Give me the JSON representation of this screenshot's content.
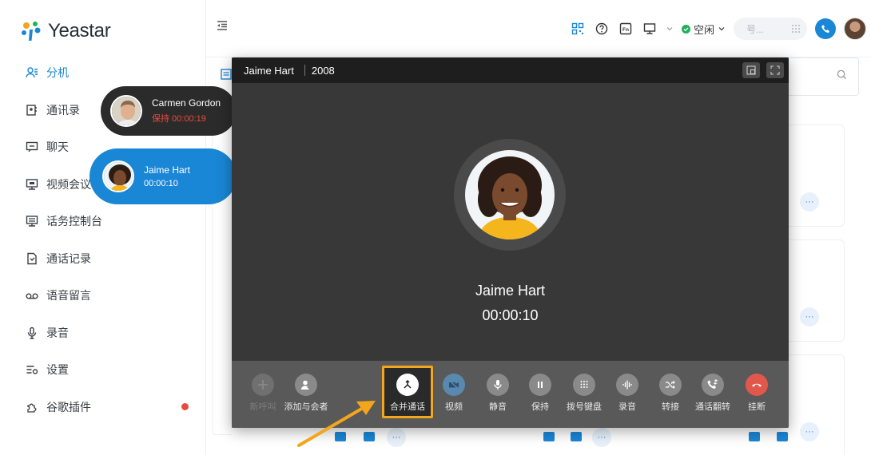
{
  "brand": {
    "name": "Yeastar"
  },
  "sidebar": {
    "items": [
      {
        "label": "分机",
        "icon": "extension-icon",
        "active": true
      },
      {
        "label": "通讯录",
        "icon": "contacts-icon"
      },
      {
        "label": "聊天",
        "icon": "chat-icon"
      },
      {
        "label": "视频会议",
        "icon": "video-conference-icon"
      },
      {
        "label": "话务控制台",
        "icon": "operator-console-icon"
      },
      {
        "label": "通话记录",
        "icon": "call-log-icon"
      },
      {
        "label": "语音留言",
        "icon": "voicemail-icon"
      },
      {
        "label": "录音",
        "icon": "microphone-icon"
      },
      {
        "label": "设置",
        "icon": "settings-icon"
      },
      {
        "label": "谷歌插件",
        "icon": "plugin-icon",
        "badge": true
      }
    ]
  },
  "topbar": {
    "status_label": "空闲",
    "dial_placeholder": "号..."
  },
  "calls": {
    "held": {
      "name": "Carmen Gordon",
      "status": "保持 00:00:19"
    },
    "active": {
      "name": "Jaime Hart",
      "duration": "00:00:10"
    }
  },
  "dialog": {
    "name": "Jaime Hart",
    "number": "2008",
    "callee_name": "Jaime Hart",
    "timer": "00:00:10",
    "buttons": [
      {
        "label": "新呼叫",
        "icon": "plus-icon",
        "state": "disabled"
      },
      {
        "label": "添加与会者",
        "icon": "add-participant-icon",
        "state": "normal"
      },
      {
        "label": "合并通话",
        "icon": "merge-call-icon",
        "state": "highlighted"
      },
      {
        "label": "视频",
        "icon": "video-icon",
        "state": "video"
      },
      {
        "label": "静音",
        "icon": "mute-icon",
        "state": "normal"
      },
      {
        "label": "保持",
        "icon": "hold-icon",
        "state": "normal"
      },
      {
        "label": "拨号键盘",
        "icon": "dialpad-icon",
        "state": "normal"
      },
      {
        "label": "录音",
        "icon": "record-icon",
        "state": "normal"
      },
      {
        "label": "转接",
        "icon": "transfer-icon",
        "state": "normal"
      },
      {
        "label": "通话翻转",
        "icon": "flip-call-icon",
        "state": "normal"
      },
      {
        "label": "挂断",
        "icon": "hangup-icon",
        "state": "hangup"
      }
    ]
  },
  "colors": {
    "accent": "#1a86d6",
    "highlight": "#f3a61c",
    "hangup": "#e2574c",
    "status_green": "#1fb25a"
  }
}
